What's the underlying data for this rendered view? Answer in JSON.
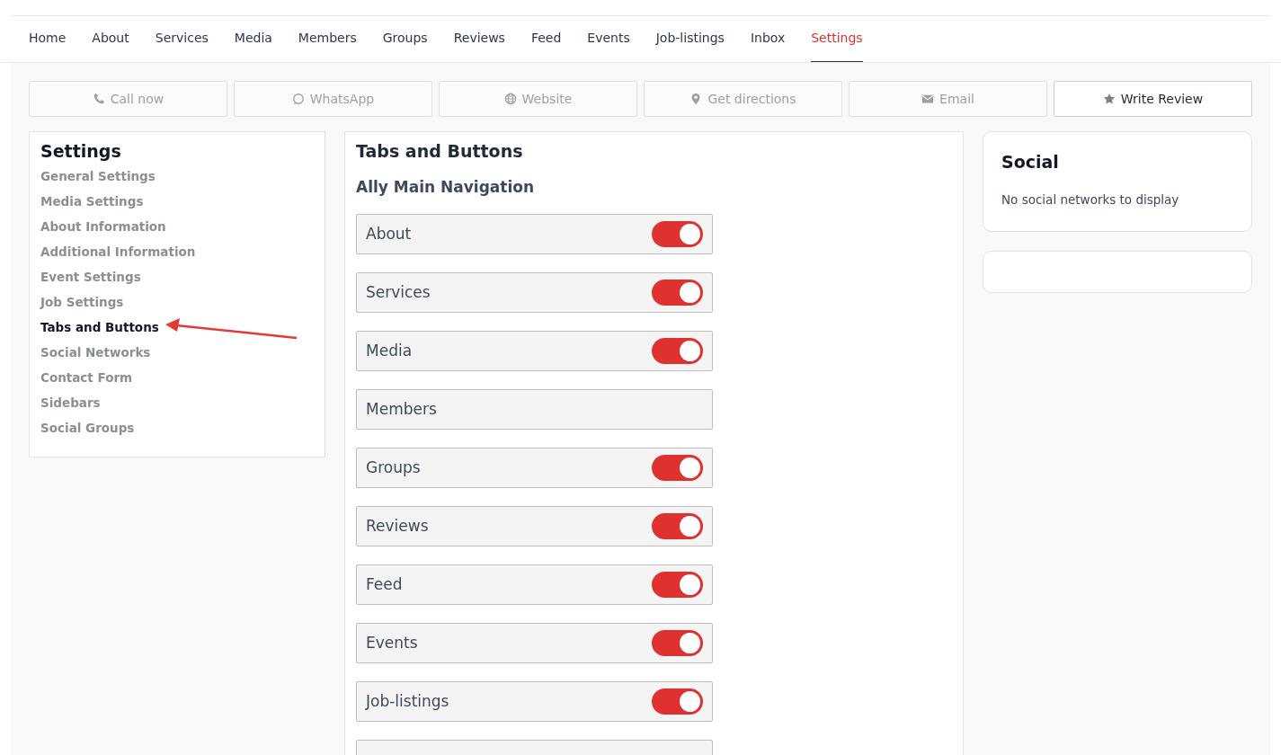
{
  "nav_tabs": [
    {
      "label": "Home",
      "selected": false
    },
    {
      "label": "About",
      "selected": false
    },
    {
      "label": "Services",
      "selected": false
    },
    {
      "label": "Media",
      "selected": false
    },
    {
      "label": "Members",
      "selected": false
    },
    {
      "label": "Groups",
      "selected": false
    },
    {
      "label": "Reviews",
      "selected": false
    },
    {
      "label": "Feed",
      "selected": false
    },
    {
      "label": "Events",
      "selected": false
    },
    {
      "label": "Job-listings",
      "selected": false
    },
    {
      "label": "Inbox",
      "selected": false
    },
    {
      "label": "Settings",
      "selected": true
    }
  ],
  "action_buttons": [
    {
      "label": "Call now",
      "kind": "phone",
      "disabled": true
    },
    {
      "label": "WhatsApp",
      "kind": "chat",
      "disabled": true
    },
    {
      "label": "Website",
      "kind": "globe",
      "disabled": true
    },
    {
      "label": "Get directions",
      "kind": "pin",
      "disabled": true
    },
    {
      "label": "Email",
      "kind": "envelope",
      "disabled": true
    },
    {
      "label": "Write Review",
      "kind": "star",
      "disabled": false
    }
  ],
  "settings_menu": {
    "title": "Settings",
    "items": [
      {
        "label": "General Settings",
        "selected": false
      },
      {
        "label": "Media Settings",
        "selected": false
      },
      {
        "label": "About Information",
        "selected": false
      },
      {
        "label": "Additional Information",
        "selected": false
      },
      {
        "label": "Event Settings",
        "selected": false
      },
      {
        "label": "Job Settings",
        "selected": false
      },
      {
        "label": "Tabs and Buttons",
        "selected": true
      },
      {
        "label": "Social Networks",
        "selected": false
      },
      {
        "label": "Contact Form",
        "selected": false
      },
      {
        "label": "Sidebars",
        "selected": false
      },
      {
        "label": "Social Groups",
        "selected": false
      }
    ]
  },
  "panel": {
    "title": "Tabs and Buttons",
    "subtitle": "Ally Main Navigation",
    "rows": [
      {
        "kind": "toggle",
        "label": "About",
        "on": true
      },
      {
        "kind": "toggle",
        "label": "Services",
        "on": true
      },
      {
        "kind": "toggle",
        "label": "Media",
        "on": true
      },
      {
        "kind": "plain",
        "label": "Members"
      },
      {
        "kind": "toggle",
        "label": "Groups",
        "on": true
      },
      {
        "kind": "toggle",
        "label": "Reviews",
        "on": true
      },
      {
        "kind": "toggle",
        "label": "Feed",
        "on": true
      },
      {
        "kind": "toggle",
        "label": "Events",
        "on": true
      },
      {
        "kind": "toggle",
        "label": "Job-listings",
        "on": true
      },
      {
        "kind": "cut"
      }
    ]
  },
  "social_card": {
    "title": "Social",
    "text": "No social networks to display"
  }
}
